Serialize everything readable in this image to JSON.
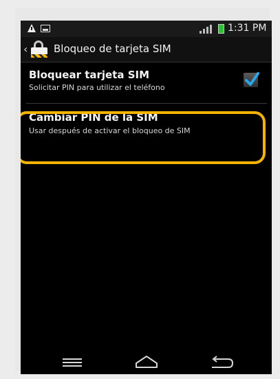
{
  "status_bar": {
    "time": "1:31 PM",
    "icons": [
      "warning-icon",
      "image-icon",
      "signal-icon",
      "battery-charging-icon"
    ],
    "battery_color": "#2fbf36"
  },
  "app_bar": {
    "title": "Bloqueo de tarjeta SIM",
    "icon": "sim-lock-icon"
  },
  "settings": [
    {
      "title": "Bloquear tarjeta SIM",
      "subtitle": "Solicitar PIN para utilizar el teléfono",
      "checked": true
    },
    {
      "title": "Cambiar PIN de la SIM",
      "subtitle": "Usar después de activar el bloqueo de SIM",
      "highlighted": true
    }
  ],
  "highlight_color": "#f2b400",
  "nav_bar": {
    "buttons": [
      "menu-icon",
      "home-icon",
      "back-icon"
    ]
  }
}
